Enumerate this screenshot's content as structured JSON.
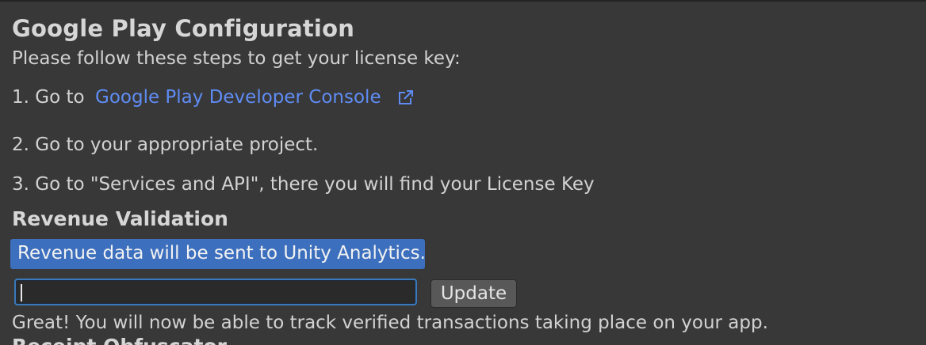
{
  "google_play": {
    "title": "Google Play Configuration",
    "intro": "Please follow these steps to get your license key:",
    "step1_prefix": "1. Go to",
    "step1_link": "Google Play Developer Console",
    "step1_link_icon": "external-link-icon",
    "step2": "2. Go to your appropriate project.",
    "step3": "3. Go to \"Services and API\", there you will find your License Key"
  },
  "revenue_validation": {
    "title": "Revenue Validation",
    "banner": "Revenue data will be sent to Unity Analytics.",
    "license_key_value": "",
    "update_label": "Update",
    "success_message": "Great! You will now be able to track verified transactions taking place on your app."
  },
  "next_section": {
    "title": "Receipt Obfuscator"
  },
  "colors": {
    "background": "#383838",
    "link": "#5f8cf4",
    "banner": "#3c6fbd",
    "input_focus_border": "#3a79bb",
    "button": "#585858"
  }
}
